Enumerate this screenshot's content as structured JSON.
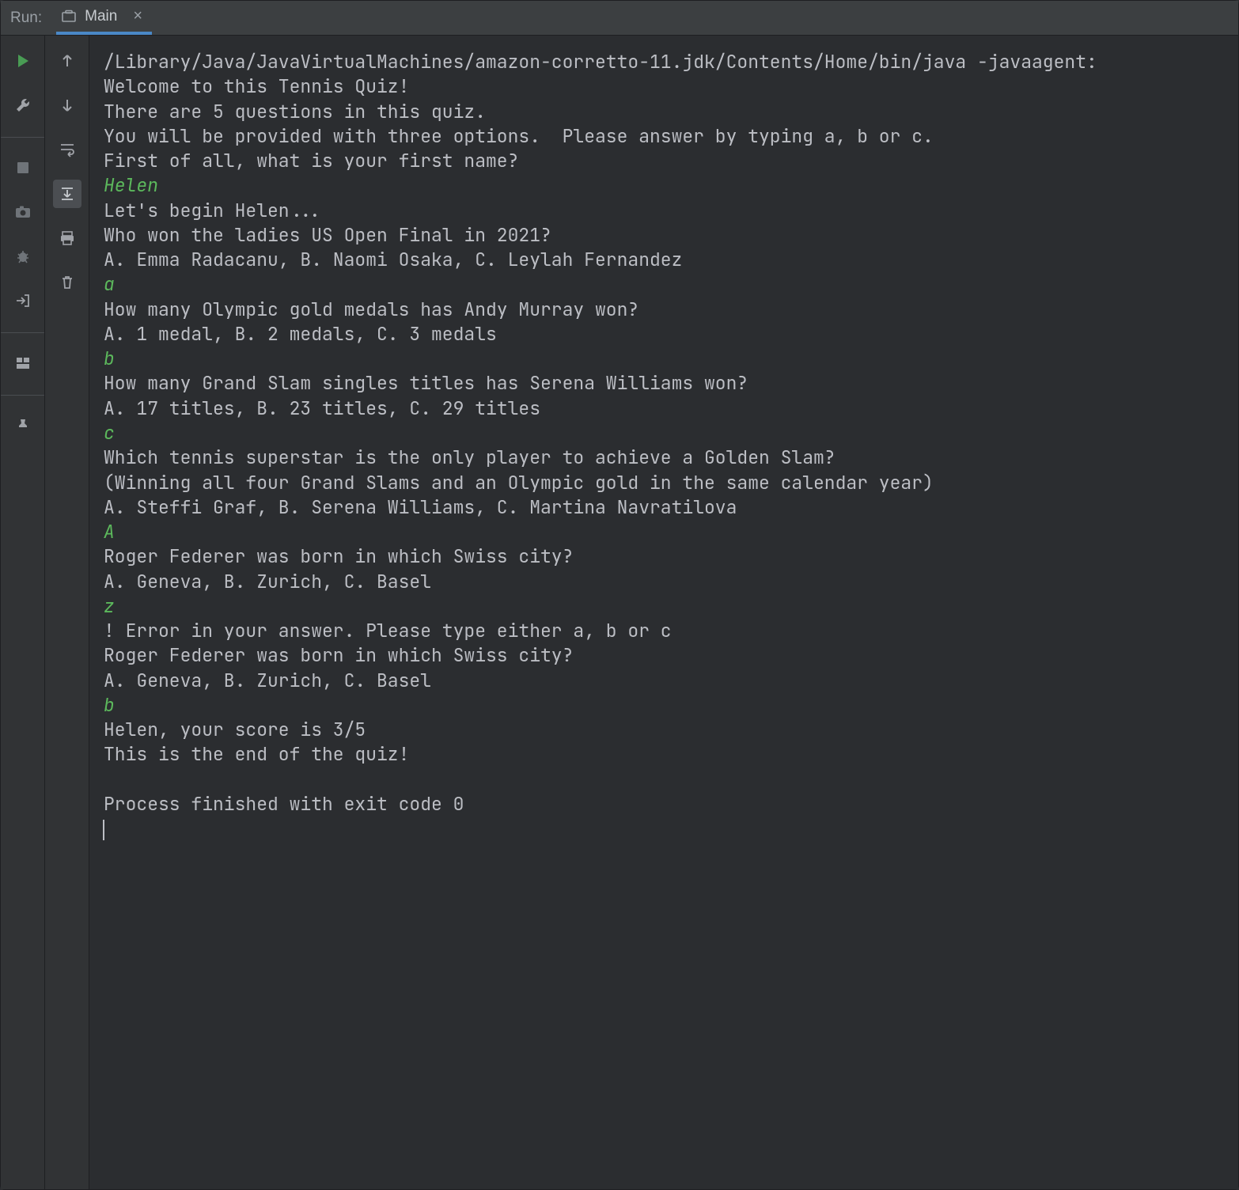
{
  "header": {
    "run_label": "Run:",
    "tab": {
      "title": "Main",
      "close_glyph": "×"
    }
  },
  "console": {
    "lines": [
      {
        "k": "out",
        "t": "/Library/Java/JavaVirtualMachines/amazon-corretto-11.jdk/Contents/Home/bin/java -javaagent:"
      },
      {
        "k": "out",
        "t": "Welcome to this Tennis Quiz!"
      },
      {
        "k": "out",
        "t": "There are 5 questions in this quiz."
      },
      {
        "k": "out",
        "t": "You will be provided with three options.  Please answer by typing a, b or c."
      },
      {
        "k": "out",
        "t": "First of all, what is your first name?"
      },
      {
        "k": "in",
        "t": "Helen"
      },
      {
        "k": "out",
        "t": "Let's begin Helen..."
      },
      {
        "k": "out",
        "t": "Who won the ladies US Open Final in 2021?"
      },
      {
        "k": "out",
        "t": "A. Emma Radacanu, B. Naomi Osaka, C. Leylah Fernandez"
      },
      {
        "k": "in",
        "t": "a"
      },
      {
        "k": "out",
        "t": "How many Olympic gold medals has Andy Murray won?"
      },
      {
        "k": "out",
        "t": "A. 1 medal, B. 2 medals, C. 3 medals"
      },
      {
        "k": "in",
        "t": "b"
      },
      {
        "k": "out",
        "t": "How many Grand Slam singles titles has Serena Williams won?"
      },
      {
        "k": "out",
        "t": "A. 17 titles, B. 23 titles, C. 29 titles"
      },
      {
        "k": "in",
        "t": "c"
      },
      {
        "k": "out",
        "t": "Which tennis superstar is the only player to achieve a Golden Slam?"
      },
      {
        "k": "out",
        "t": "(Winning all four Grand Slams and an Olympic gold in the same calendar year)"
      },
      {
        "k": "out",
        "t": "A. Steffi Graf, B. Serena Williams, C. Martina Navratilova"
      },
      {
        "k": "in",
        "t": "A"
      },
      {
        "k": "out",
        "t": "Roger Federer was born in which Swiss city?"
      },
      {
        "k": "out",
        "t": "A. Geneva, B. Zurich, C. Basel"
      },
      {
        "k": "in",
        "t": "z"
      },
      {
        "k": "out",
        "t": "! Error in your answer. Please type either a, b or c"
      },
      {
        "k": "out",
        "t": "Roger Federer was born in which Swiss city?"
      },
      {
        "k": "out",
        "t": "A. Geneva, B. Zurich, C. Basel"
      },
      {
        "k": "in",
        "t": "b"
      },
      {
        "k": "out",
        "t": "Helen, your score is 3/5"
      },
      {
        "k": "out",
        "t": "This is the end of the quiz!"
      },
      {
        "k": "out",
        "t": ""
      },
      {
        "k": "out",
        "t": "Process finished with exit code 0"
      }
    ]
  }
}
